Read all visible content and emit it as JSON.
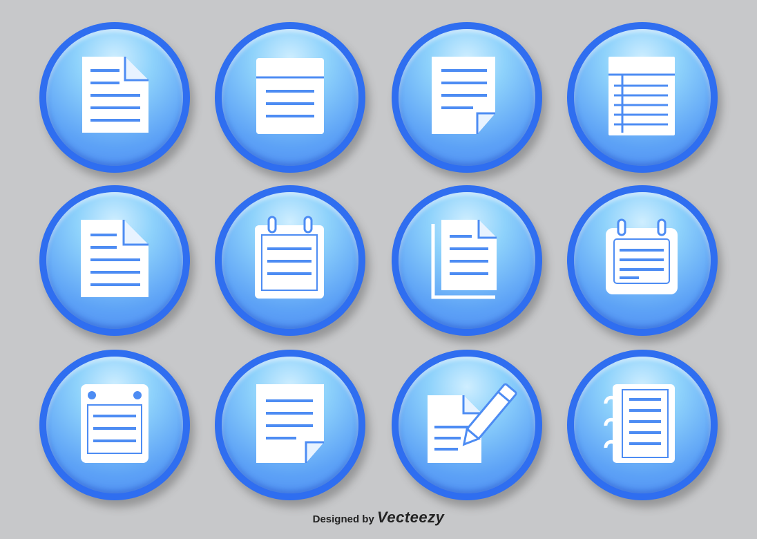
{
  "credit": {
    "prefix": "Designed by",
    "brand": "Vecteezy"
  },
  "colors": {
    "background": "#c7c8ca",
    "ring": "#2f6ef0",
    "icon": "#ffffff"
  },
  "icons": [
    {
      "name": "document-folded-corner-icon"
    },
    {
      "name": "document-header-lines-icon"
    },
    {
      "name": "document-curled-corner-icon"
    },
    {
      "name": "spreadsheet-document-icon"
    },
    {
      "name": "document-folded-corner-icon"
    },
    {
      "name": "notepad-rings-icon"
    },
    {
      "name": "stacked-documents-icon"
    },
    {
      "name": "calendar-note-icon"
    },
    {
      "name": "notepad-pins-icon"
    },
    {
      "name": "document-page-curl-icon"
    },
    {
      "name": "document-pencil-edit-icon"
    },
    {
      "name": "spiral-notebook-icon"
    }
  ]
}
